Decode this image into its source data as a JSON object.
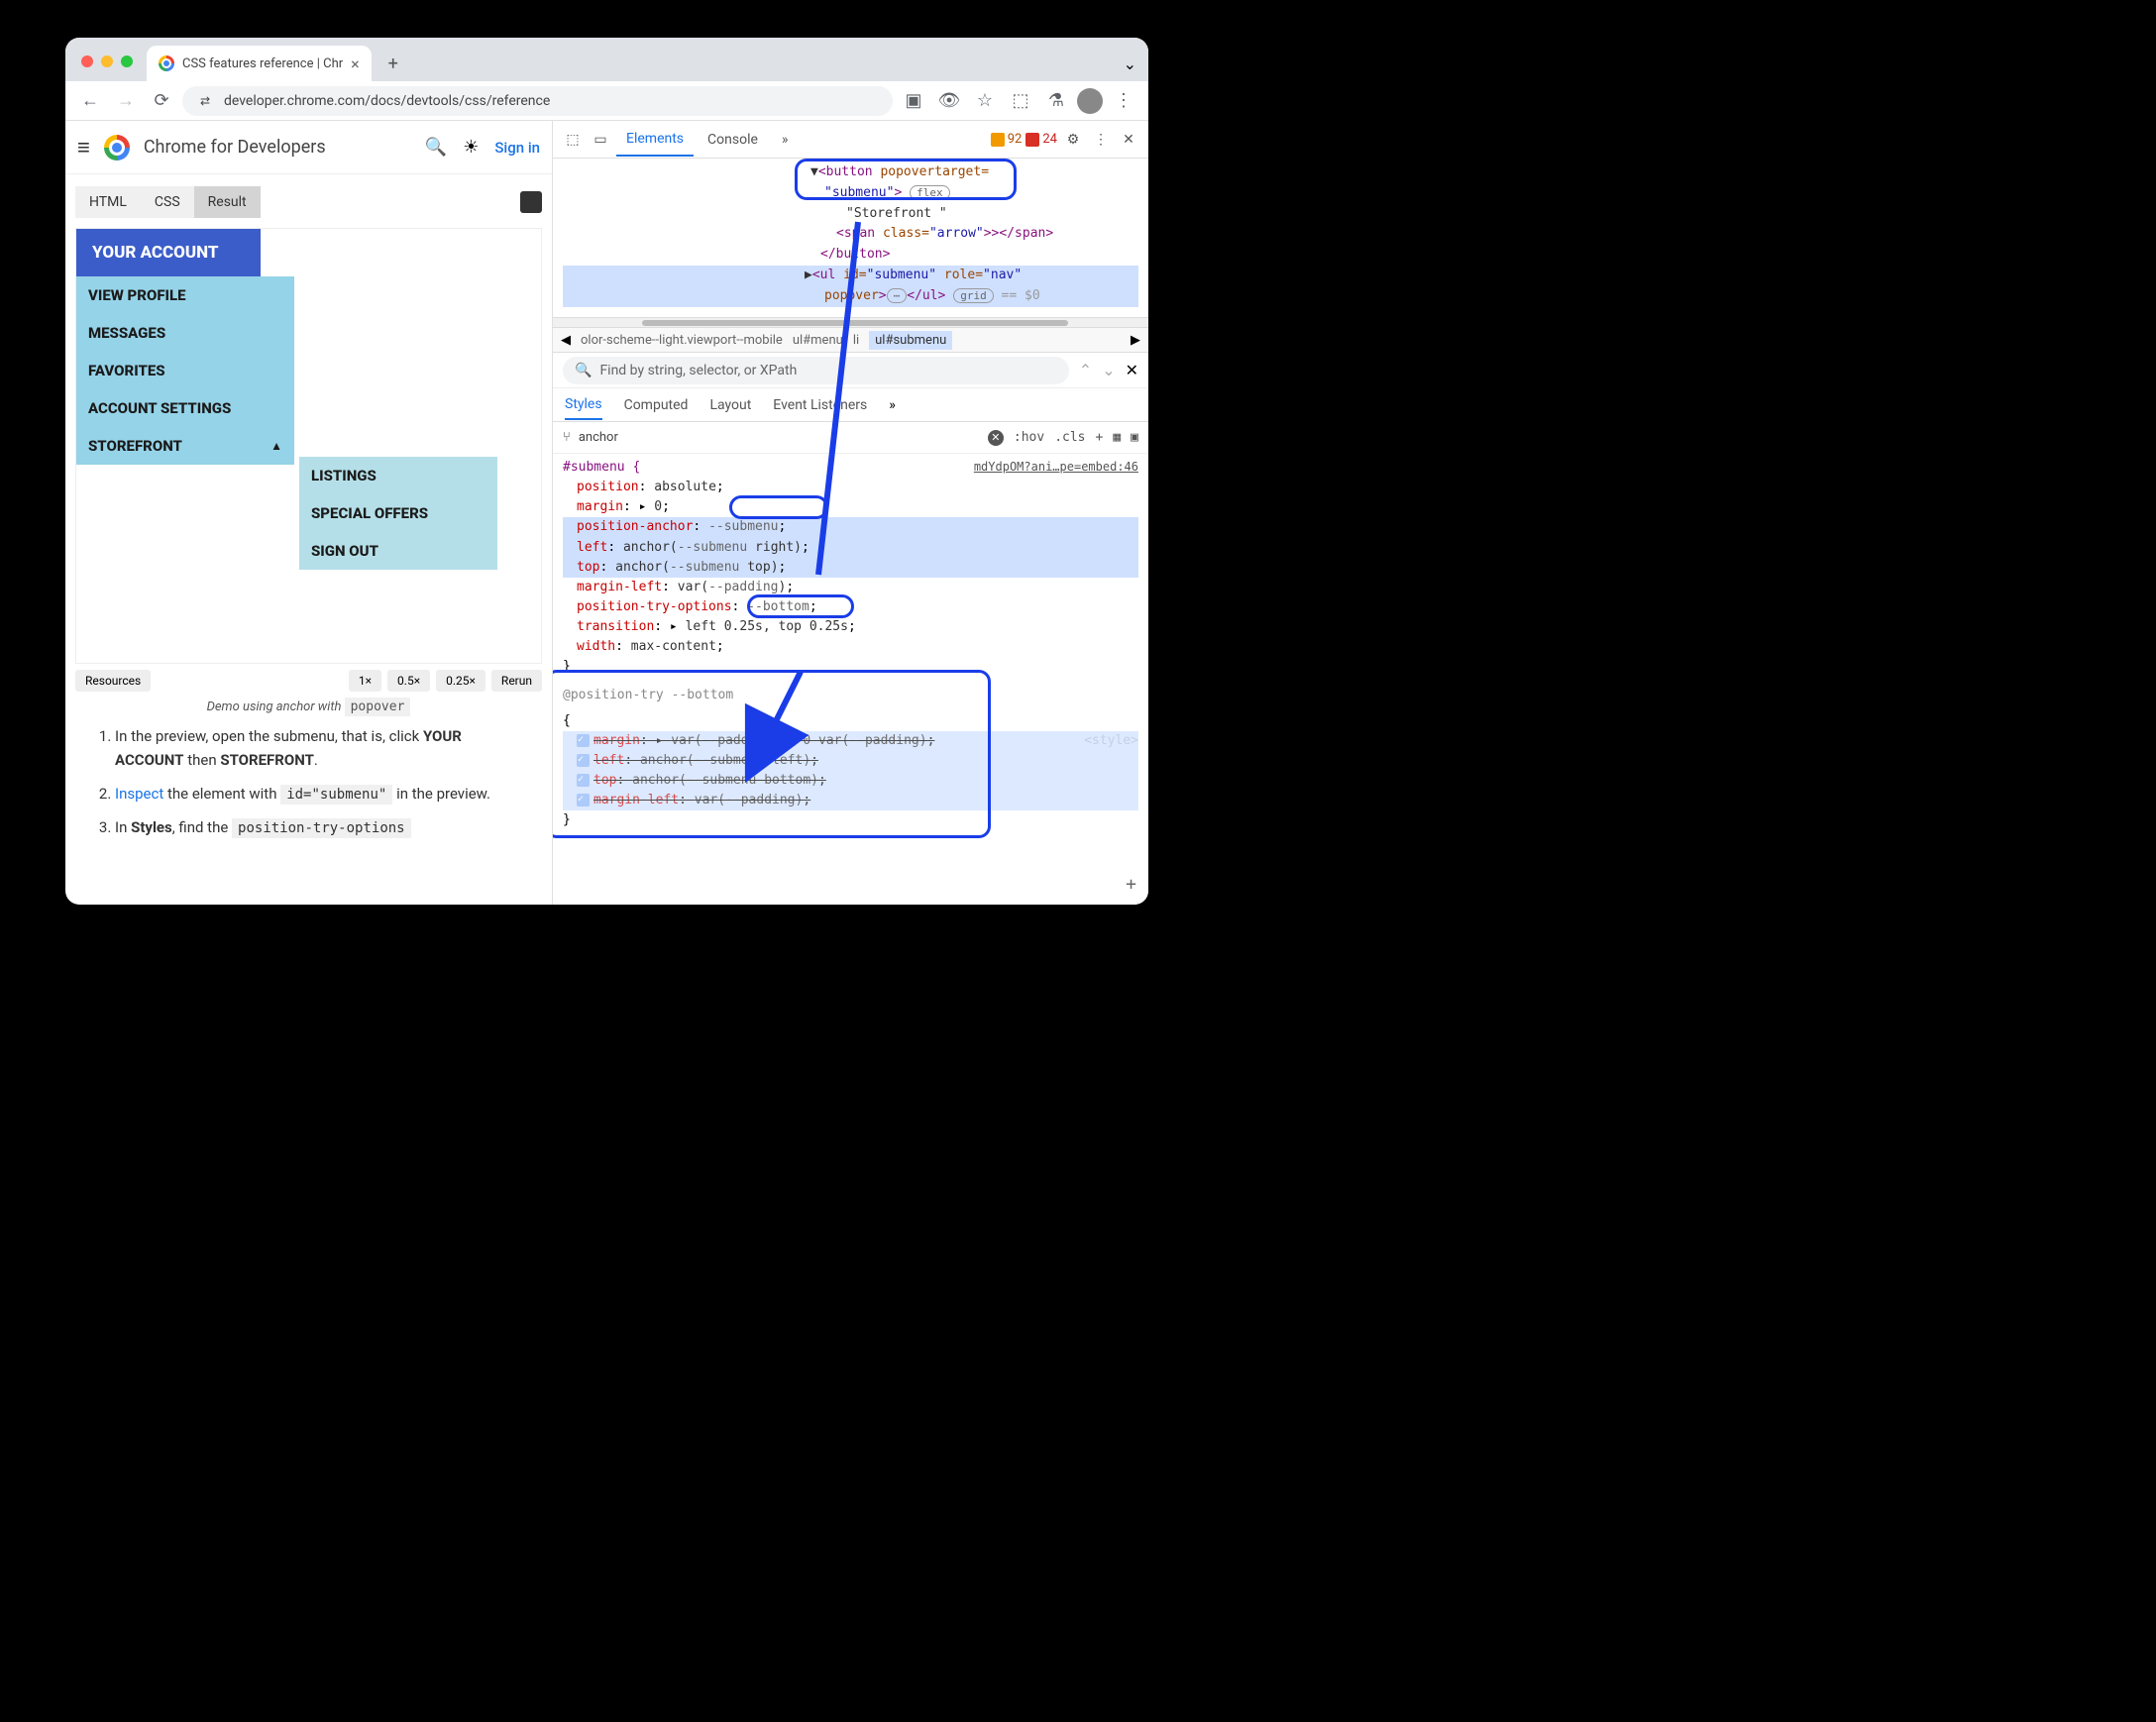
{
  "tab": {
    "title": "CSS features reference  |  Chr"
  },
  "omnibox": {
    "url": "developer.chrome.com/docs/devtools/css/reference"
  },
  "page": {
    "brand": "Chrome for Developers",
    "signin": "Sign in"
  },
  "codeTabs": {
    "html": "HTML",
    "css": "CSS",
    "result": "Result"
  },
  "demo": {
    "yourAccount": "YOUR ACCOUNT",
    "viewProfile": "VIEW PROFILE",
    "messages": "MESSAGES",
    "favorites": "FAVORITES",
    "accountSettings": "ACCOUNT SETTINGS",
    "storefront": "STOREFRONT",
    "listings": "LISTINGS",
    "specialOffers": "SPECIAL OFFERS",
    "signOut": "SIGN OUT"
  },
  "demoFooter": {
    "resources": "Resources",
    "z1": "1×",
    "z05": "0.5×",
    "z025": "0.25×",
    "rerun": "Rerun"
  },
  "caption": {
    "text": "Demo using anchor with ",
    "code": "popover"
  },
  "steps": {
    "s1a": "In the preview, open the submenu, that is, click ",
    "s1b": "YOUR ACCOUNT",
    "s1c": " then ",
    "s1d": "STOREFRONT",
    "s1e": ".",
    "s2a": "Inspect",
    "s2b": " the element with ",
    "s2code": "id=\"submenu\"",
    "s2c": " in the preview.",
    "s3a": "In ",
    "s3b": "Styles",
    "s3c": ", find the ",
    "s3code": "position-try-options"
  },
  "devtools": {
    "tabs": {
      "elements": "Elements",
      "console": "Console"
    },
    "warnings": "92",
    "errors": "24"
  },
  "elementsHtml": {
    "l1a": "<button",
    "l1b": " popovertarget=",
    "l2a": "\"submenu\"",
    "l2b": ">",
    "l2pill": "flex",
    "l3": "\"Storefront \"",
    "l4a": "<span",
    "l4b": " class=",
    "l4c": "\"arrow\"",
    "l4d": ">></span>",
    "l5": "</button>",
    "l6a": "<ul",
    "l6b": " id=",
    "l6c": "\"submenu\"",
    "l6d": " role=",
    "l6e": "\"nav\"",
    "l7a": "popover",
    "l7b": ">…</ul>",
    "l7pill": "grid",
    "l7eq": " == $0"
  },
  "breadcrumb": {
    "c1": "olor-scheme--light.viewport--mobile",
    "c2": "ul#menu",
    "c3": "li",
    "c4": "ul#submenu"
  },
  "find": {
    "placeholder": "Find by string, selector, or XPath"
  },
  "stylesTabs": {
    "styles": "Styles",
    "computed": "Computed",
    "layout": "Layout",
    "eventListeners": "Event Listeners"
  },
  "filter": {
    "text": "anchor",
    "hov": ":hov",
    "cls": ".cls"
  },
  "css": {
    "selector": "#submenu {",
    "source": "mdYdpOM?ani…pe=embed:46",
    "position": "position",
    "positionV": "absolute",
    "margin": "margin",
    "marginV": "0",
    "positionAnchor": "position-anchor",
    "positionAnchorV": "--submenu",
    "left": "left",
    "leftV1": "anchor(",
    "leftV2": "--submenu",
    "leftV3": " right)",
    "top": "top",
    "topV1": "anchor(",
    "topV2": "--submenu",
    "topV3": " top)",
    "marginLeft": "margin-left",
    "marginLeftV1": "var(",
    "marginLeftV2": "--padding",
    "marginLeftV3": ")",
    "positionTryOptions": "position-try-options",
    "positionTryOptionsV": "--bottom",
    "transition": "transition",
    "transitionV": "left 0.25s, top 0.25s",
    "width": "width",
    "widthV": "max-content",
    "close": "}",
    "atRule": "@position-try --bottom",
    "open2": "{",
    "styleTag": "<style>",
    "r2margin": "margin",
    "r2marginV": "var(--padding) 0 0 var(--padding)",
    "r2left": "left",
    "r2leftV": "anchor(--submenu left)",
    "r2top": "top",
    "r2topV": "anchor(--submenu bottom)",
    "r2marginLeft": "margin-left",
    "r2marginLeftV": "var(--padding)",
    "close2": "}"
  }
}
